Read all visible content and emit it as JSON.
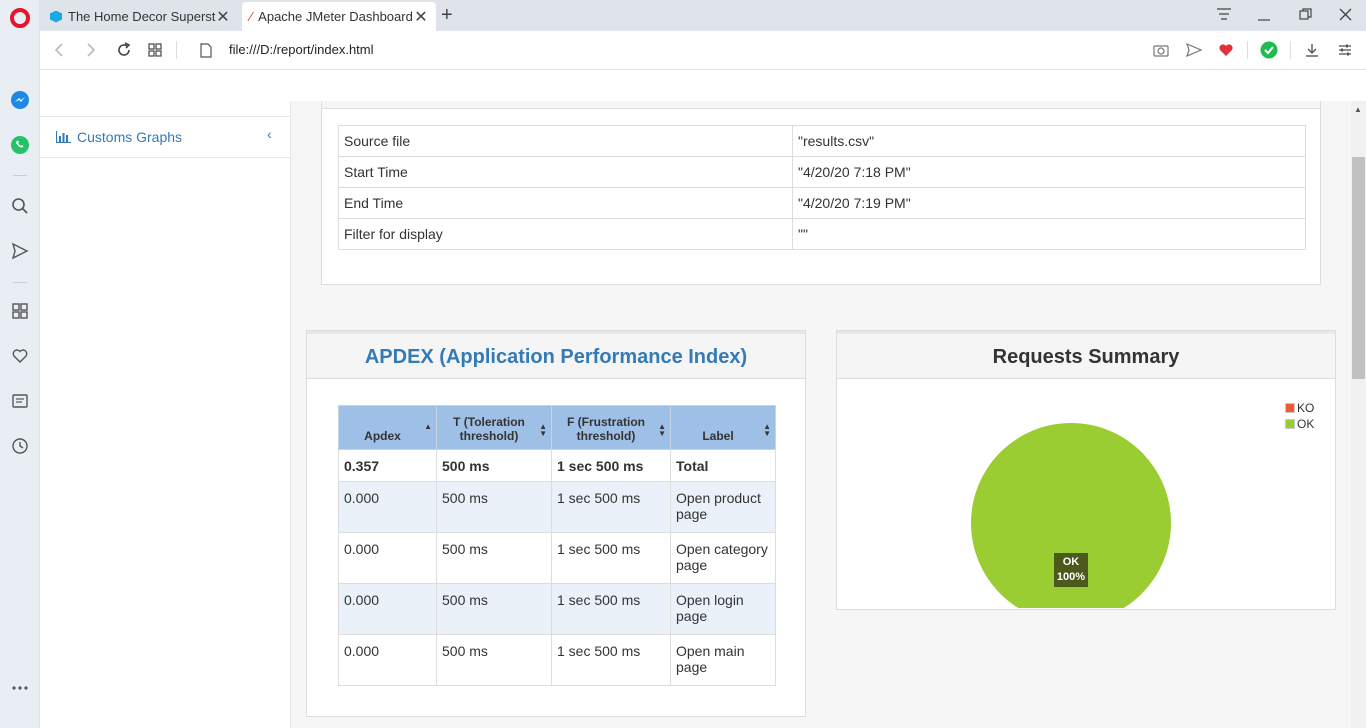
{
  "browser": {
    "tabs": [
      {
        "title": "The Home Decor Superstore",
        "active": false
      },
      {
        "title": "Apache JMeter Dashboard",
        "active": true
      }
    ],
    "url": "file:///D:/report/index.html"
  },
  "sidebar": {
    "menu_item": "Customs Graphs"
  },
  "info_table": {
    "rows": [
      {
        "label": "Source file",
        "value": "\"results.csv\""
      },
      {
        "label": "Start Time",
        "value": "\"4/20/20 7:18 PM\""
      },
      {
        "label": "End Time",
        "value": "\"4/20/20 7:19 PM\""
      },
      {
        "label": "Filter for display",
        "value": "\"\""
      }
    ]
  },
  "apdex": {
    "title": "APDEX (Application Performance Index)",
    "headers": [
      "Apdex",
      "T (Toleration threshold)",
      "F (Frustration threshold)",
      "Label"
    ],
    "total": {
      "apdex": "0.357",
      "t": "500 ms",
      "f": "1 sec 500 ms",
      "label": "Total"
    },
    "rows": [
      {
        "apdex": "0.000",
        "t": "500 ms",
        "f": "1 sec 500 ms",
        "label": "Open product page"
      },
      {
        "apdex": "0.000",
        "t": "500 ms",
        "f": "1 sec 500 ms",
        "label": "Open category page"
      },
      {
        "apdex": "0.000",
        "t": "500 ms",
        "f": "1 sec 500 ms",
        "label": "Open login page"
      },
      {
        "apdex": "0.000",
        "t": "500 ms",
        "f": "1 sec 500 ms",
        "label": "Open main page"
      }
    ]
  },
  "requests_summary": {
    "title": "Requests Summary",
    "legend": [
      {
        "name": "KO",
        "color": "#ee5a36"
      },
      {
        "name": "OK",
        "color": "#9acd32"
      }
    ],
    "slice_label": "OK",
    "slice_pct": "100%"
  },
  "chart_data": {
    "type": "pie",
    "title": "Requests Summary",
    "categories": [
      "KO",
      "OK"
    ],
    "values": [
      0,
      100
    ],
    "colors": [
      "#ee5a36",
      "#9acd32"
    ],
    "legend": "top-right"
  }
}
